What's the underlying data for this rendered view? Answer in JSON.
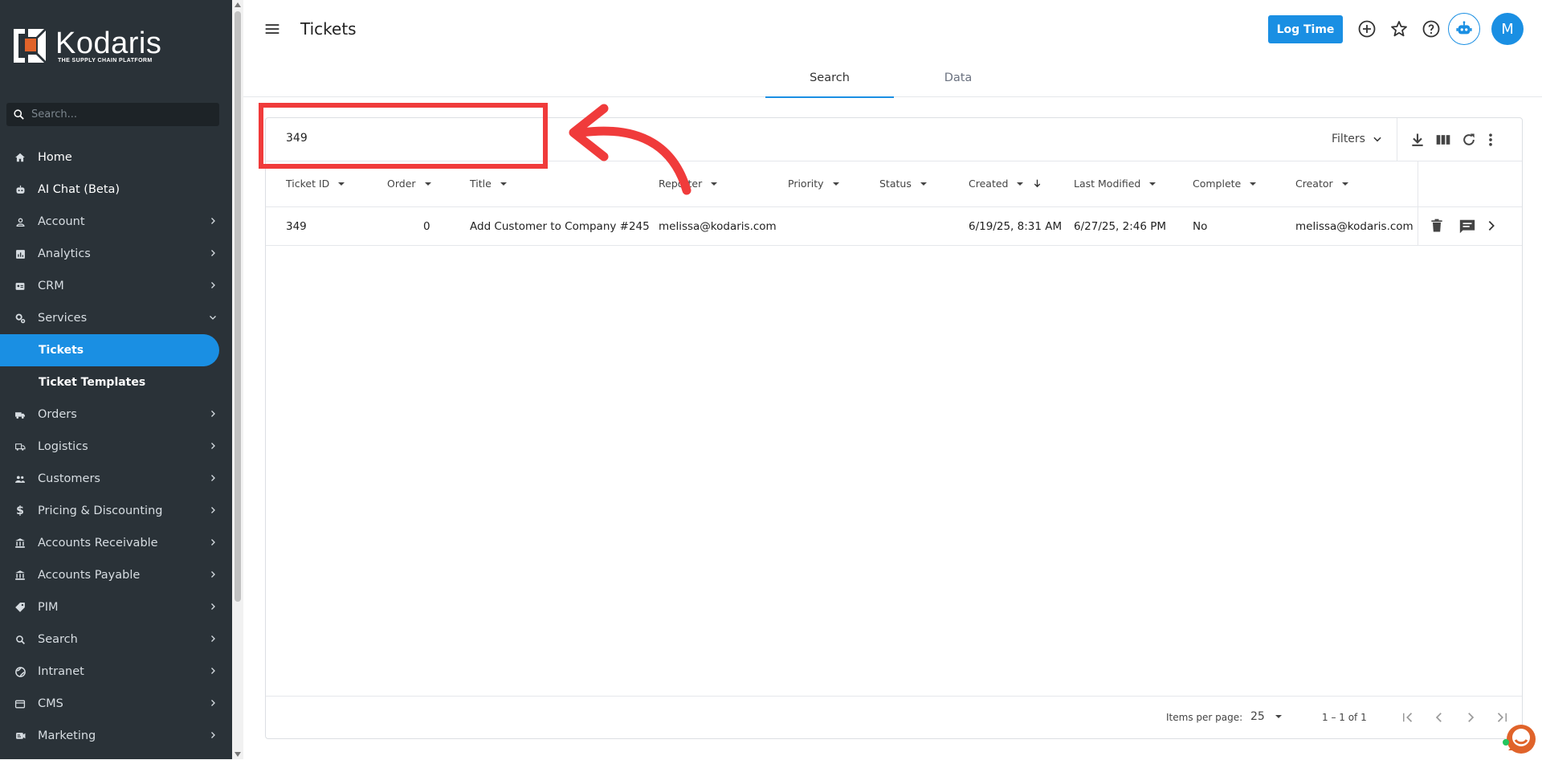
{
  "brand": {
    "name": "Kodaris",
    "tagline": "THE SUPPLY CHAIN PLATFORM"
  },
  "sidebar": {
    "search_placeholder": "Search...",
    "items": [
      {
        "label": "Home",
        "icon": "home-icon"
      },
      {
        "label": "AI Chat (Beta)",
        "icon": "robot-icon"
      },
      {
        "label": "Account",
        "icon": "person-icon"
      },
      {
        "label": "Analytics",
        "icon": "analytics-icon"
      },
      {
        "label": "CRM",
        "icon": "contact-card-icon"
      },
      {
        "label": "Services",
        "icon": "services-gears-icon"
      },
      {
        "label": "Tickets"
      },
      {
        "label": "Ticket Templates"
      },
      {
        "label": "Orders",
        "icon": "truck-icon"
      },
      {
        "label": "Logistics",
        "icon": "shipping-icon"
      },
      {
        "label": "Customers",
        "icon": "people-icon"
      },
      {
        "label": "Pricing & Discounting",
        "icon": "dollar-icon"
      },
      {
        "label": "Accounts Receivable",
        "icon": "bank-icon"
      },
      {
        "label": "Accounts Payable",
        "icon": "bank-icon"
      },
      {
        "label": "PIM",
        "icon": "tag-icon"
      },
      {
        "label": "Search",
        "icon": "search-icon"
      },
      {
        "label": "Intranet",
        "icon": "globe-icon"
      },
      {
        "label": "CMS",
        "icon": "cms-icon"
      },
      {
        "label": "Marketing",
        "icon": "marketing-icon"
      }
    ]
  },
  "header": {
    "title": "Tickets",
    "log_time_label": "Log Time",
    "avatar_initial": "M"
  },
  "tabs": [
    {
      "label": "Search",
      "active": true
    },
    {
      "label": "Data",
      "active": false
    }
  ],
  "toolbar": {
    "search_value": "349",
    "filters_label": "Filters"
  },
  "table": {
    "columns": [
      "Ticket ID",
      "Order",
      "Title",
      "Reporter",
      "Priority",
      "Status",
      "Created",
      "Last Modified",
      "Complete",
      "Creator"
    ],
    "sort": {
      "column": "Created",
      "direction": "desc"
    },
    "rows": [
      {
        "ticket_id": "349",
        "order": "0",
        "title": "Add Customer to Company #245",
        "reporter": "melissa@kodaris.com",
        "priority": "",
        "status": "",
        "created": "6/19/25, 8:31 AM",
        "last_modified": "6/27/25, 2:46 PM",
        "complete": "No",
        "creator": "melissa@kodaris.com"
      }
    ]
  },
  "pagination": {
    "items_per_page_label": "Items per page:",
    "items_per_page": "25",
    "range": "1 – 1 of 1"
  },
  "colors": {
    "sidebar_bg": "#2a3238",
    "accent": "#1a8fe3",
    "annotation": "#f03b3b",
    "brand_orange": "#e0632a"
  }
}
